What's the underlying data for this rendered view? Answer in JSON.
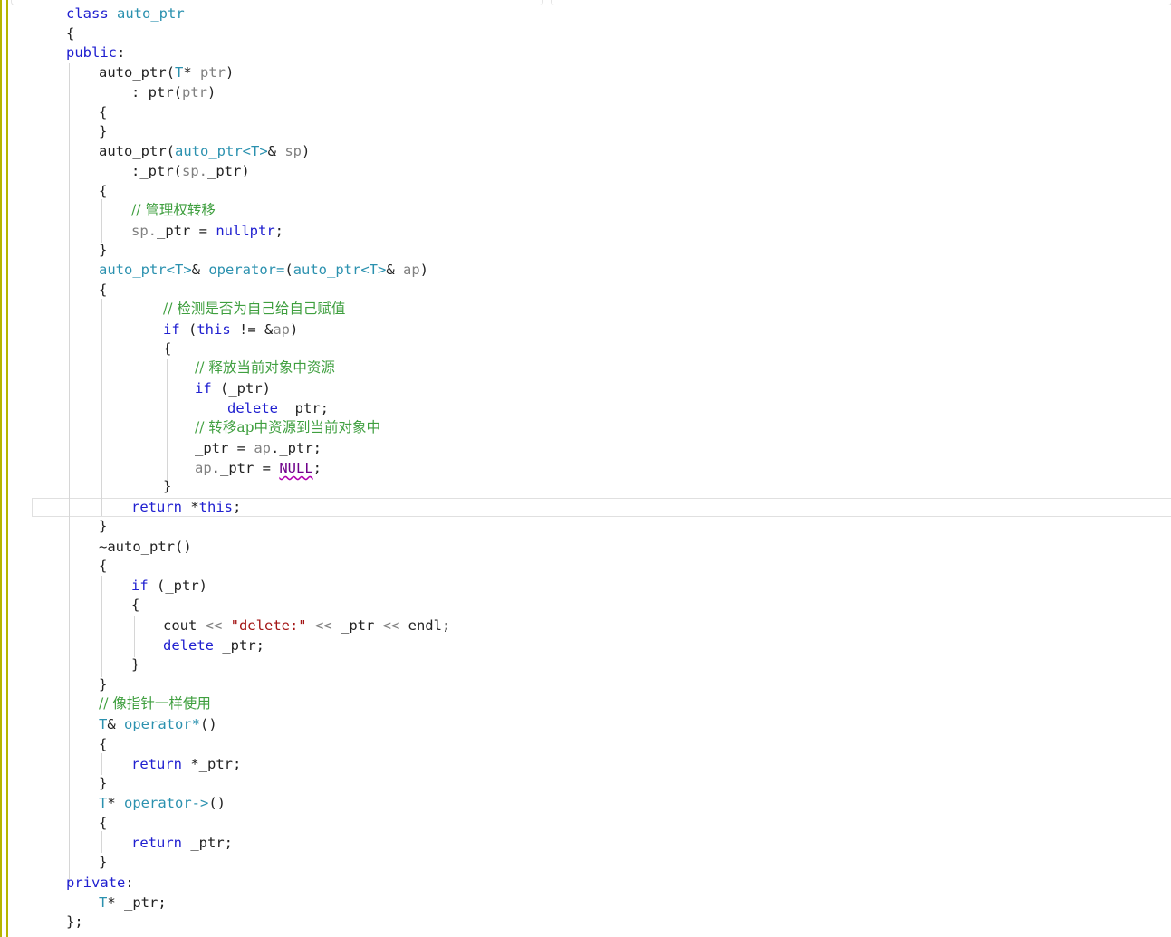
{
  "editor": {
    "language": "C++",
    "highlight_colors": {
      "keyword": "#2020d0",
      "type": "#2b91af",
      "comment": "#3f9f3f",
      "string": "#a31515",
      "parameter": "#808080",
      "macro": "#6f008a",
      "margin_marker": "#b5b500"
    }
  },
  "code": {
    "l1_class": "class",
    "l1_name": "auto_ptr",
    "l2": "{",
    "l3_public": "public",
    "l3_colon": ":",
    "l4_name": "auto_ptr",
    "l4_open": "(",
    "l4_type": "T",
    "l4_star": "* ",
    "l4_param": "ptr",
    "l4_close": ")",
    "l5_init": ":_ptr",
    "l5_open": "(",
    "l5_param": "ptr",
    "l5_close": ")",
    "l6": "{",
    "l7": "}",
    "l8_name": "auto_ptr",
    "l8_open": "(",
    "l8_type": "auto_ptr<T>",
    "l8_amp": "& ",
    "l8_param": "sp",
    "l8_close": ")",
    "l9_init": ":_ptr",
    "l9_open": "(",
    "l9_param": "sp.",
    "l9_member": "_ptr)",
    "l10": "{",
    "l11_comment": "// 管理权转移",
    "l12_param": "sp.",
    "l12_member": "_ptr = ",
    "l12_null": "nullptr",
    "l12_semi": ";",
    "l13": "}",
    "l14_type": "auto_ptr<T>",
    "l14_amp": "& ",
    "l14_op": "operator=",
    "l14_open": "(",
    "l14_ptype": "auto_ptr<T>",
    "l14_pamp": "& ",
    "l14_param": "ap",
    "l14_close": ")",
    "l15": "{",
    "l16_comment": "// 检测是否为自己给自己赋值",
    "l17_if": "if",
    "l17_open": " (",
    "l17_this": "this",
    "l17_ne": " != &",
    "l17_param": "ap",
    "l17_close": ")",
    "l18": "{",
    "l19_comment": "// 释放当前对象中资源",
    "l20_if": "if",
    "l20_cond": " (_ptr)",
    "l21_delete": "delete",
    "l21_rest": " _ptr;",
    "l22_comment": "// 转移ap中资源到当前对象中",
    "l23_lhs": "_ptr = ",
    "l23_param": "ap",
    "l23_rest": "._ptr;",
    "l24_param": "ap",
    "l24_mid": "._ptr = ",
    "l24_null": "NULL",
    "l24_semi": ";",
    "l25": "}",
    "l26_return": "return",
    "l26_star": " *",
    "l26_this": "this",
    "l26_semi": ";",
    "l27": "}",
    "l28_tilde": "~",
    "l28_name": "auto_ptr",
    "l28_paren": "()",
    "l29": "{",
    "l30_if": "if",
    "l30_cond": " (_ptr)",
    "l31": "{",
    "l32_cout": "cout",
    "l32_op1": " << ",
    "l32_str": "\"delete:\"",
    "l32_op2": " << ",
    "l32_ptr": "_ptr",
    "l32_op3": " << ",
    "l32_endl": "endl;",
    "l33_delete": "delete",
    "l33_rest": " _ptr;",
    "l34": "}",
    "l35": "}",
    "l36_comment": "// 像指针一样使用",
    "l37_type": "T",
    "l37_amp": "& ",
    "l37_op": "operator*",
    "l37_paren": "()",
    "l38": "{",
    "l39_return": "return",
    "l39_rest": " *_ptr;",
    "l40": "}",
    "l41_type": "T",
    "l41_star": "* ",
    "l41_op": "operator->",
    "l41_paren": "()",
    "l42": "{",
    "l43_return": "return",
    "l43_rest": " _ptr;",
    "l44": "}",
    "l45_private": "private",
    "l45_colon": ":",
    "l46_type": "T",
    "l46_rest": "* _ptr;",
    "l47": "};"
  }
}
